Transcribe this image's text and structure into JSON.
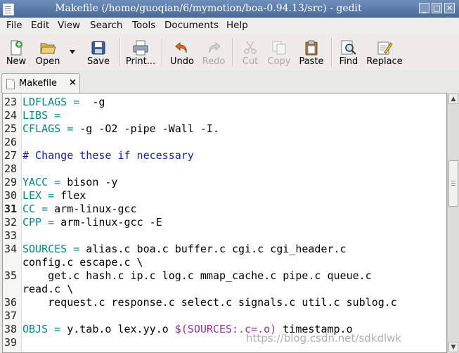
{
  "window": {
    "title": "Makefile (/home/guoqian/6/mymotion/boa-0.94.13/src) - gedit",
    "controls": {
      "minimize": "_",
      "maximize": "□",
      "close": "✕"
    }
  },
  "menubar": {
    "items": [
      {
        "label": "File"
      },
      {
        "label": "Edit"
      },
      {
        "label": "View"
      },
      {
        "label": "Search"
      },
      {
        "label": "Tools"
      },
      {
        "label": "Documents"
      },
      {
        "label": "Help"
      }
    ]
  },
  "toolbar": {
    "new": "New",
    "open": "Open",
    "save": "Save",
    "print": "Print...",
    "undo": "Undo",
    "redo": "Redo",
    "cut": "Cut",
    "copy": "Copy",
    "paste": "Paste",
    "find": "Find",
    "replace": "Replace",
    "disabled": [
      "Redo",
      "Cut",
      "Copy"
    ]
  },
  "tab": {
    "name": "Makefile",
    "close": "×"
  },
  "editor": {
    "current_line": "31",
    "lines": [
      {
        "num": "23",
        "parts": [
          {
            "t": "LDFLAGS =",
            "c": "kw"
          },
          {
            "t": "  -g",
            "c": ""
          }
        ]
      },
      {
        "num": "24",
        "parts": [
          {
            "t": "LIBS =",
            "c": "kw"
          }
        ]
      },
      {
        "num": "25",
        "parts": [
          {
            "t": "CFLAGS =",
            "c": "kw"
          },
          {
            "t": " -g -O2 -pipe -Wall -I.",
            "c": ""
          }
        ]
      },
      {
        "num": "26",
        "parts": []
      },
      {
        "num": "27",
        "parts": [
          {
            "t": "# Change these if necessary",
            "c": "cm"
          }
        ]
      },
      {
        "num": "28",
        "parts": []
      },
      {
        "num": "29",
        "parts": [
          {
            "t": "YACC =",
            "c": "kw"
          },
          {
            "t": " bison -y",
            "c": ""
          }
        ]
      },
      {
        "num": "30",
        "parts": [
          {
            "t": "LEX =",
            "c": "kw"
          },
          {
            "t": " flex",
            "c": ""
          }
        ]
      },
      {
        "num": "31",
        "parts": [
          {
            "t": "CC =",
            "c": "kw"
          },
          {
            "t": " arm-linux-gcc",
            "c": ""
          }
        ]
      },
      {
        "num": "32",
        "parts": [
          {
            "t": "CPP =",
            "c": "kw"
          },
          {
            "t": " arm-linux-gcc -E",
            "c": ""
          }
        ]
      },
      {
        "num": "33",
        "parts": []
      },
      {
        "num": "34",
        "parts": [
          {
            "t": "SOURCES =",
            "c": "kw"
          },
          {
            "t": " alias.c boa.c buffer.c cgi.c cgi_header.c",
            "c": ""
          }
        ]
      },
      {
        "num": "",
        "parts": [
          {
            "t": "config.c escape.c \\",
            "c": ""
          }
        ]
      },
      {
        "num": "35",
        "parts": [
          {
            "t": "    get.c hash.c ip.c log.c mmap_cache.c pipe.c queue.c",
            "c": ""
          }
        ]
      },
      {
        "num": "",
        "parts": [
          {
            "t": "read.c \\",
            "c": ""
          }
        ]
      },
      {
        "num": "36",
        "parts": [
          {
            "t": "    request.c response.c select.c signals.c util.c sublog.c",
            "c": ""
          }
        ]
      },
      {
        "num": "37",
        "parts": []
      },
      {
        "num": "38",
        "parts": [
          {
            "t": "OBJS =",
            "c": "kw"
          },
          {
            "t": " y.tab.o lex.yy.o ",
            "c": ""
          },
          {
            "t": "$(SOURCES:.c=.o)",
            "c": "vr"
          },
          {
            "t": " timestamp.o",
            "c": ""
          }
        ]
      },
      {
        "num": "39",
        "parts": []
      }
    ]
  },
  "watermark": "https://blog.csdn.net/sdkdlwk"
}
